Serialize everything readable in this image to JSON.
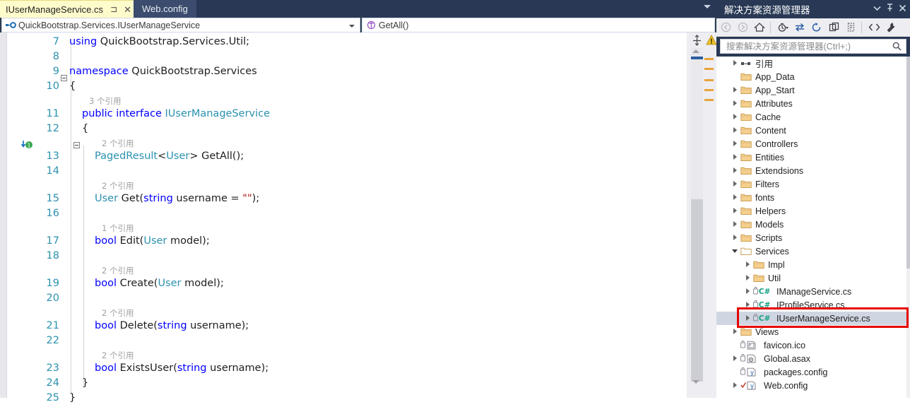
{
  "editor": {
    "tabs": [
      {
        "label": "IUserManageService.cs",
        "active": true,
        "pin_icon": "pin-icon",
        "close_icon": "close-icon"
      },
      {
        "label": "Web.config",
        "active": false
      }
    ],
    "navbar": {
      "type_scope": "QuickBootstrap.Services.IUserManageService",
      "member_scope": "GetAll()",
      "type_icon": "interface-icon",
      "member_icon": "method-icon"
    },
    "code_lines": [
      {
        "no": "7",
        "lens": null,
        "tokens": [
          {
            "t": "using ",
            "c": "kw"
          },
          {
            "t": "QuickBootstrap.Services.Util;",
            "c": "pl"
          }
        ],
        "indent": 0
      },
      {
        "no": "8",
        "lens": null,
        "tokens": [],
        "indent": 0
      },
      {
        "no": "9",
        "lens": null,
        "tokens": [
          {
            "t": "namespace ",
            "c": "kw"
          },
          {
            "t": "QuickBootstrap.Services",
            "c": "pl"
          }
        ],
        "indent": 0
      },
      {
        "no": "10",
        "lens": null,
        "tokens": [
          {
            "t": "{",
            "c": "pl"
          }
        ],
        "indent": 0
      },
      {
        "no": "11",
        "lens": "3 个引用",
        "tokens": [
          {
            "t": "public interface ",
            "c": "kw"
          },
          {
            "t": "IUserManageService",
            "c": "ty"
          }
        ],
        "indent": 1
      },
      {
        "no": "12",
        "lens": null,
        "tokens": [
          {
            "t": "{",
            "c": "pl"
          }
        ],
        "indent": 1
      },
      {
        "no": "13",
        "lens": "2 个引用",
        "tokens": [
          {
            "t": "PagedResult",
            "c": "ty"
          },
          {
            "t": "<",
            "c": "pl"
          },
          {
            "t": "User",
            "c": "ty"
          },
          {
            "t": "> GetAll();",
            "c": "pl"
          }
        ],
        "indent": 2
      },
      {
        "no": "14",
        "lens": null,
        "tokens": [],
        "indent": 2
      },
      {
        "no": "15",
        "lens": "2 个引用",
        "tokens": [
          {
            "t": "User",
            "c": "ty"
          },
          {
            "t": " Get(",
            "c": "pl"
          },
          {
            "t": "string",
            "c": "kw"
          },
          {
            "t": " username = ",
            "c": "pl"
          },
          {
            "t": "\"\"",
            "c": "st"
          },
          {
            "t": ");",
            "c": "pl"
          }
        ],
        "indent": 2
      },
      {
        "no": "16",
        "lens": null,
        "tokens": [],
        "indent": 2
      },
      {
        "no": "17",
        "lens": "1 个引用",
        "tokens": [
          {
            "t": "bool",
            "c": "kw"
          },
          {
            "t": " Edit(",
            "c": "pl"
          },
          {
            "t": "User",
            "c": "ty"
          },
          {
            "t": " model);",
            "c": "pl"
          }
        ],
        "indent": 2
      },
      {
        "no": "18",
        "lens": null,
        "tokens": [],
        "indent": 2
      },
      {
        "no": "19",
        "lens": "2 个引用",
        "tokens": [
          {
            "t": "bool",
            "c": "kw"
          },
          {
            "t": " Create(",
            "c": "pl"
          },
          {
            "t": "User",
            "c": "ty"
          },
          {
            "t": " model);",
            "c": "pl"
          }
        ],
        "indent": 2
      },
      {
        "no": "20",
        "lens": null,
        "tokens": [],
        "indent": 2
      },
      {
        "no": "21",
        "lens": "2 个引用",
        "tokens": [
          {
            "t": "bool",
            "c": "kw"
          },
          {
            "t": " Delete(",
            "c": "pl"
          },
          {
            "t": "string",
            "c": "kw"
          },
          {
            "t": " username);",
            "c": "pl"
          }
        ],
        "indent": 2
      },
      {
        "no": "22",
        "lens": null,
        "tokens": [],
        "indent": 2
      },
      {
        "no": "23",
        "lens": "2 个引用",
        "tokens": [
          {
            "t": "bool",
            "c": "kw"
          },
          {
            "t": " ExistsUser(",
            "c": "pl"
          },
          {
            "t": "string",
            "c": "kw"
          },
          {
            "t": " username);",
            "c": "pl"
          }
        ],
        "indent": 2
      },
      {
        "no": "24",
        "lens": null,
        "tokens": [
          {
            "t": "}",
            "c": "pl"
          }
        ],
        "indent": 1
      },
      {
        "no": "25",
        "lens": null,
        "tokens": [
          {
            "t": "}",
            "c": "pl"
          }
        ],
        "indent": 0
      }
    ],
    "gutter": {
      "split_icon": "split-window-icon",
      "warning_icon": "warning-icon",
      "scroll_up_icon": "scroll-up-arrow",
      "scroll_down_icon": "scroll-down-arrow"
    }
  },
  "solution_explorer": {
    "title": "解决方案资源管理器",
    "title_icons": [
      "chevron-down-icon",
      "pin-icon",
      "close-icon"
    ],
    "toolbar_icons": [
      "back-arrow-icon",
      "forward-arrow-icon",
      "home-icon",
      "pending-changes-filter-icon",
      "sync-with-active-document-icon",
      "refresh-icon",
      "collapse-all-icon",
      "show-all-files-icon",
      "view-code-icon",
      "properties-icon"
    ],
    "search": {
      "placeholder": "搜索解决方案资源管理器(Ctrl+;)",
      "value": "",
      "icon": "search-icon"
    },
    "tree": [
      {
        "label": "引用",
        "icon": "references-icon",
        "indent": 1,
        "arrow": "closed",
        "selected": false
      },
      {
        "label": "App_Data",
        "icon": "folder-icon",
        "indent": 1,
        "arrow": "none",
        "selected": false
      },
      {
        "label": "App_Start",
        "icon": "folder-icon",
        "indent": 1,
        "arrow": "closed",
        "selected": false
      },
      {
        "label": "Attributes",
        "icon": "folder-icon",
        "indent": 1,
        "arrow": "closed",
        "selected": false
      },
      {
        "label": "Cache",
        "icon": "folder-icon",
        "indent": 1,
        "arrow": "closed",
        "selected": false
      },
      {
        "label": "Content",
        "icon": "folder-icon",
        "indent": 1,
        "arrow": "closed",
        "selected": false
      },
      {
        "label": "Controllers",
        "icon": "folder-icon",
        "indent": 1,
        "arrow": "closed",
        "selected": false
      },
      {
        "label": "Entities",
        "icon": "folder-icon",
        "indent": 1,
        "arrow": "closed",
        "selected": false
      },
      {
        "label": "Extendsions",
        "icon": "folder-icon",
        "indent": 1,
        "arrow": "closed",
        "selected": false
      },
      {
        "label": "Filters",
        "icon": "folder-icon",
        "indent": 1,
        "arrow": "closed",
        "selected": false
      },
      {
        "label": "fonts",
        "icon": "folder-icon",
        "indent": 1,
        "arrow": "closed",
        "selected": false
      },
      {
        "label": "Helpers",
        "icon": "folder-icon",
        "indent": 1,
        "arrow": "closed",
        "selected": false
      },
      {
        "label": "Models",
        "icon": "folder-icon",
        "indent": 1,
        "arrow": "closed",
        "selected": false
      },
      {
        "label": "Scripts",
        "icon": "folder-icon",
        "indent": 1,
        "arrow": "closed",
        "selected": false
      },
      {
        "label": "Services",
        "icon": "folder-open-icon",
        "indent": 1,
        "arrow": "open",
        "selected": false
      },
      {
        "label": "Impl",
        "icon": "folder-icon",
        "indent": 2,
        "arrow": "closed",
        "selected": false
      },
      {
        "label": "Util",
        "icon": "folder-icon",
        "indent": 2,
        "arrow": "closed",
        "selected": false
      },
      {
        "label": "IManageService.cs",
        "icon": "csharp-file-icon",
        "indent": 2,
        "arrow": "closed",
        "selected": false
      },
      {
        "label": "IProfileService.cs",
        "icon": "csharp-file-icon",
        "indent": 2,
        "arrow": "closed",
        "selected": false
      },
      {
        "label": "IUserManageService.cs",
        "icon": "csharp-file-icon",
        "indent": 2,
        "arrow": "closed",
        "selected": true
      },
      {
        "label": "Views",
        "icon": "folder-icon",
        "indent": 1,
        "arrow": "closed",
        "selected": false
      },
      {
        "label": "favicon.ico",
        "icon": "image-file-icon",
        "indent": 1,
        "arrow": "none",
        "selected": false
      },
      {
        "label": "Global.asax",
        "icon": "asax-file-icon",
        "indent": 1,
        "arrow": "closed",
        "selected": false
      },
      {
        "label": "packages.config",
        "icon": "config-file-icon",
        "indent": 1,
        "arrow": "none",
        "selected": false
      },
      {
        "label": "Web.config",
        "icon": "config-file-checked-icon",
        "indent": 1,
        "arrow": "closed",
        "selected": false
      }
    ]
  },
  "annotation": {
    "highlight_color": "#e60000",
    "target": "IUserManageService.cs"
  }
}
